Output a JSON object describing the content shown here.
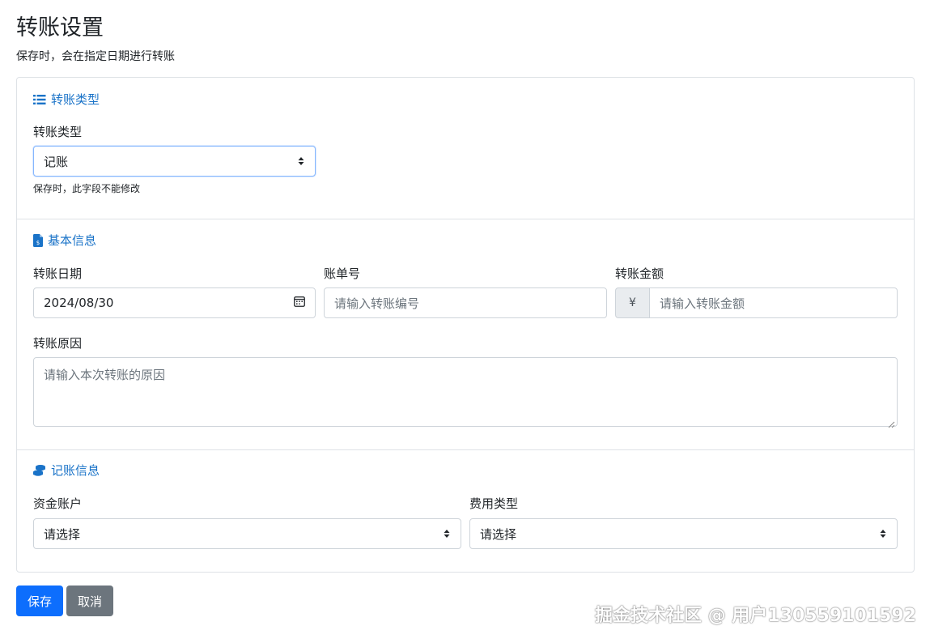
{
  "page": {
    "title": "转账设置",
    "subtitle": "保存时，会在指定日期进行转账"
  },
  "sections": {
    "transfer_type": {
      "header": "转账类型",
      "icon": "list-icon",
      "field_label": "转账类型",
      "select_value": "记账",
      "help_text": "保存时，此字段不能修改"
    },
    "basic_info": {
      "header": "基本信息",
      "icon": "invoice-icon",
      "date_label": "转账日期",
      "date_value": "2024/08/30",
      "bill_no_label": "账单号",
      "bill_no_placeholder": "请输入转账编号",
      "amount_label": "转账金额",
      "amount_prefix": "¥",
      "amount_placeholder": "请输入转账金额",
      "reason_label": "转账原因",
      "reason_placeholder": "请输入本次转账的原因"
    },
    "accounting_info": {
      "header": "记账信息",
      "icon": "coins-icon",
      "account_label": "资金账户",
      "account_value": "请选择",
      "expense_type_label": "费用类型",
      "expense_type_value": "请选择"
    }
  },
  "actions": {
    "save_label": "保存",
    "cancel_label": "取消"
  },
  "watermark": "掘金技术社区 @ 用户130559101592",
  "colors": {
    "primary": "#0d6efd",
    "secondary": "#6c757d",
    "section_header": "#1a73c8"
  }
}
